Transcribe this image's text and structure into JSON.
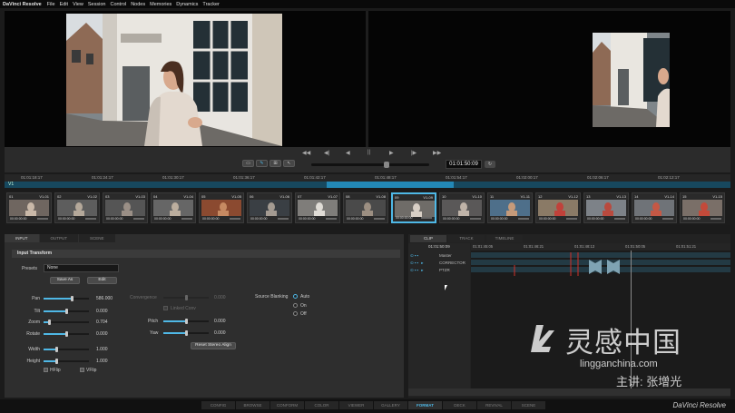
{
  "menubar": {
    "app_name": "DaVinci Resolve",
    "items": [
      "File",
      "Edit",
      "View",
      "Session",
      "Control",
      "Nodes",
      "Memories",
      "Dynamics",
      "Tracker"
    ]
  },
  "transport": {
    "timecode": "01:01:50:09",
    "buttons": [
      "◀◀",
      "◀|",
      "◀",
      "||",
      "▶",
      "|▶",
      "▶▶"
    ]
  },
  "ruler": {
    "track_label": "V1",
    "ticks": [
      "01:01:18:17",
      "01:01:24:17",
      "01:01:30:17",
      "01:01:36:17",
      "01:01:42:17",
      "01:01:48:17",
      "01:01:54:17",
      "01:02:00:17",
      "01:02:06:17",
      "01:02:12:17"
    ]
  },
  "thumbs": [
    {
      "num": "01",
      "id": "V1-01",
      "tc": "00:00:00:00"
    },
    {
      "num": "02",
      "id": "V1-02",
      "tc": "00:00:00:00"
    },
    {
      "num": "03",
      "id": "V1-03",
      "tc": "00:00:00:00"
    },
    {
      "num": "04",
      "id": "V1-04",
      "tc": "00:00:00:00"
    },
    {
      "num": "05",
      "id": "V1-05",
      "tc": "00:00:00:00"
    },
    {
      "num": "06",
      "id": "V1-06",
      "tc": "00:00:00:00"
    },
    {
      "num": "07",
      "id": "V1-07",
      "tc": "00:00:00:00"
    },
    {
      "num": "08",
      "id": "V1-08",
      "tc": "00:00:00:00"
    },
    {
      "num": "09",
      "id": "V1-09",
      "tc": "00:00:00:00"
    },
    {
      "num": "10",
      "id": "V1-10",
      "tc": "00:00:00:00"
    },
    {
      "num": "11",
      "id": "V1-11",
      "tc": "00:00:00:00"
    },
    {
      "num": "12",
      "id": "V1-12",
      "tc": "00:00:00:00"
    },
    {
      "num": "13",
      "id": "V1-13",
      "tc": "00:00:00:00"
    },
    {
      "num": "14",
      "id": "V1-14",
      "tc": "00:00:00:00"
    },
    {
      "num": "15",
      "id": "V1-15",
      "tc": "00:00:00:00"
    }
  ],
  "left_panel": {
    "tabs": [
      "INPUT",
      "OUTPUT",
      "SCENE"
    ],
    "section_title": "Input Transform",
    "presets_label": "Presets",
    "presets_value": "None",
    "save_as": "Save As",
    "edit": "Edit",
    "params": [
      {
        "label": "Pan",
        "value": "586.000",
        "level": 0.62
      },
      {
        "label": "Tilt",
        "value": "0.000",
        "level": 0.5
      },
      {
        "label": "Zoom",
        "value": "0.704",
        "level": 0.12
      },
      {
        "label": "Rotate",
        "value": "0.000",
        "level": 0.5
      },
      {
        "label": "Width",
        "value": "1.000",
        "level": 0.28
      },
      {
        "label": "Height",
        "value": "1.000",
        "level": 0.28
      }
    ],
    "hflip": "HFlip",
    "vflip": "VFlip",
    "convergence_label": "Convergence",
    "convergence_value": "0.000",
    "linked_label": "Linked Conv",
    "pitch_label": "Pitch",
    "pitch_value": "0.000",
    "yaw_label": "Yaw",
    "yaw_value": "0.000",
    "reset_stereo": "Reset Stereo Align",
    "source_blanking_label": "Source Blanking",
    "blanking_options": [
      "Auto",
      "On",
      "Off"
    ]
  },
  "right_panel": {
    "tabs": [
      "CLIP",
      "TRACK",
      "TIMELINE"
    ],
    "current_tc": "01:01:50:09",
    "ruler": [
      "01:01:45:05",
      "01:01:46:21",
      "01:01:48:13",
      "01:01:50:05",
      "01:01:51:21"
    ],
    "tracks": [
      "Master",
      "CORRECTOR",
      "PTZR"
    ]
  },
  "bottom": {
    "tabs": [
      "CONFIG",
      "BROWSE",
      "CONFORM",
      "COLOR",
      "VIEWER",
      "GALLERY",
      "FORMAT",
      "DECK",
      "REVIVAL",
      "SCENE"
    ],
    "active_tab": "FORMAT",
    "brand": "DaVinci Resolve"
  },
  "watermark": {
    "name": "灵感中国",
    "url": "lingganchina.com",
    "author": "主讲: 张增光"
  },
  "colors": {
    "accent": "#4fb8e6",
    "timeline_blue": "#2388b6",
    "keyframe_red": "#d0302a"
  }
}
